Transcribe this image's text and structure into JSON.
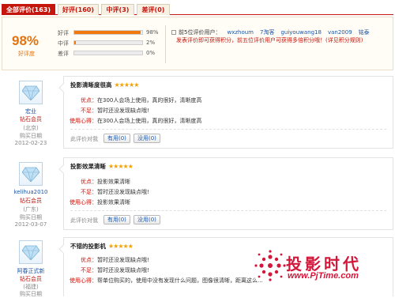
{
  "tabs": [
    {
      "label": "全部评价(163)",
      "active": true
    },
    {
      "label": "好评(160)",
      "active": false
    },
    {
      "label": "中评(3)",
      "active": false
    },
    {
      "label": "差评(0)",
      "active": false
    }
  ],
  "summary": {
    "good_rate": "98%",
    "good_rate_label": "好评度",
    "rates": [
      {
        "label": "好评",
        "percent": "98%",
        "fraction": 0.98
      },
      {
        "label": "中评",
        "percent": "2%",
        "fraction": 0.02
      },
      {
        "label": "差评",
        "percent": "0%",
        "fraction": 0.0
      }
    ],
    "top_users_prefix": "前5位评价用户：",
    "top_users": [
      "wxzhoum",
      "7淘客",
      "guiyouwang18",
      "van2009",
      "铭泰"
    ],
    "promo": "发表评价即可获得积分，前五位评价用户可获得多倍积分哦！(详见积分规则)"
  },
  "reviews": [
    {
      "user": "宏业",
      "level": "钻石会员",
      "location": "(北京)",
      "buy_label": "购买日期",
      "date": "2012-02-23",
      "title": "投影清晰度很高",
      "stars": "★★★★★",
      "pros_label": "优点：",
      "pros": "在300人会场上使用，真的很好，清晰度高",
      "cons_label": "不足：",
      "cons": "暂时还没发现缺点哦!",
      "exp_label": "使用心得：",
      "exp": "在300人会场上使用，真的很好，清晰度高",
      "vote_question": "此评价对我",
      "useful_btn": "有用(0)",
      "useless_btn": "没用(0)"
    },
    {
      "user": "kelihua2010",
      "level": "钻石会员",
      "location": "(广东)",
      "buy_label": "购买日期",
      "date": "2012-03-07",
      "title": "投影效果清晰",
      "stars": "★★★★★",
      "pros_label": "优点：",
      "pros": "投影效果清晰",
      "cons_label": "不足：",
      "cons": "暂时还没发现缺点哦!",
      "exp_label": "使用心得：",
      "exp": "投影效果清晰",
      "vote_question": "此评价对我",
      "useful_btn": "有用(0)",
      "useless_btn": "没用(0)"
    },
    {
      "user": "阿春正式新",
      "level": "钻石会员",
      "location": "(福建)",
      "buy_label": "购买日期",
      "date": "",
      "title": "不错的投影机",
      "stars": "★★★★★",
      "pros_label": "优点：",
      "pros": "暂时还没发现缺点哦!",
      "cons_label": "不足：",
      "cons": "暂时还没发现缺点哦!",
      "exp_label": "使用心得：",
      "exp": "帮单位购买的，使用中没有发现什么问题，图像很清晰，距离这么...",
      "vote_question": "",
      "useful_btn": "",
      "useless_btn": ""
    }
  ],
  "watermark": {
    "title": "投影时代",
    "url": "www.PjTime.com"
  },
  "colors": {
    "brand_red": "#c5160d",
    "accent_orange": "#f07a0f",
    "link_blue": "#1c56a7",
    "star_gold": "#f2a100",
    "watermark_red": "#d3173a"
  }
}
